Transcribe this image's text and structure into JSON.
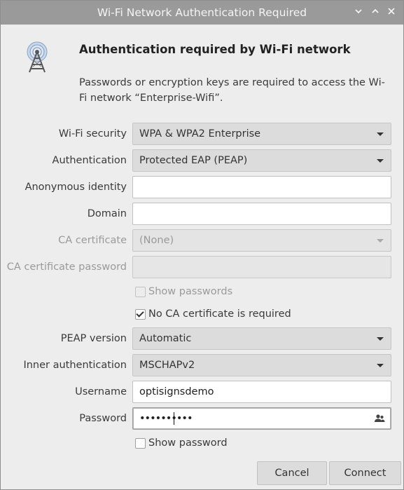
{
  "window": {
    "title": "Wi-Fi Network Authentication Required",
    "controls": [
      "chevron-down-icon",
      "chevron-up-icon",
      "close-icon"
    ]
  },
  "header": {
    "heading": "Authentication required by Wi-Fi network",
    "description": "Passwords or encryption keys are required to access the Wi-Fi network “Enterprise-Wifi”."
  },
  "form": {
    "wifi_security": {
      "label": "Wi-Fi security",
      "value": "WPA & WPA2 Enterprise"
    },
    "authentication": {
      "label": "Authentication",
      "value": "Protected EAP (PEAP)"
    },
    "anonymous_identity": {
      "label": "Anonymous identity",
      "value": ""
    },
    "domain": {
      "label": "Domain",
      "value": ""
    },
    "ca_certificate": {
      "label": "CA certificate",
      "value": "(None)"
    },
    "ca_certificate_password": {
      "label": "CA certificate password",
      "value": ""
    },
    "show_passwords": {
      "label": "Show passwords",
      "checked": false
    },
    "no_ca_required": {
      "label": "No CA certificate is required",
      "checked": true
    },
    "peap_version": {
      "label": "PEAP version",
      "value": "Automatic"
    },
    "inner_authentication": {
      "label": "Inner authentication",
      "value": "MSCHAPv2"
    },
    "username": {
      "label": "Username",
      "value": "optisignsdemo"
    },
    "password": {
      "label": "Password",
      "masked_value": "••••••••••",
      "icon": "user-group-icon"
    },
    "show_password": {
      "label": "Show password",
      "checked": false
    }
  },
  "buttons": {
    "cancel": "Cancel",
    "connect": "Connect"
  },
  "colors": {
    "titlebar": "#9a9a9a",
    "dialog_bg": "#ededed",
    "combo_bg": "#dcdcdc"
  }
}
